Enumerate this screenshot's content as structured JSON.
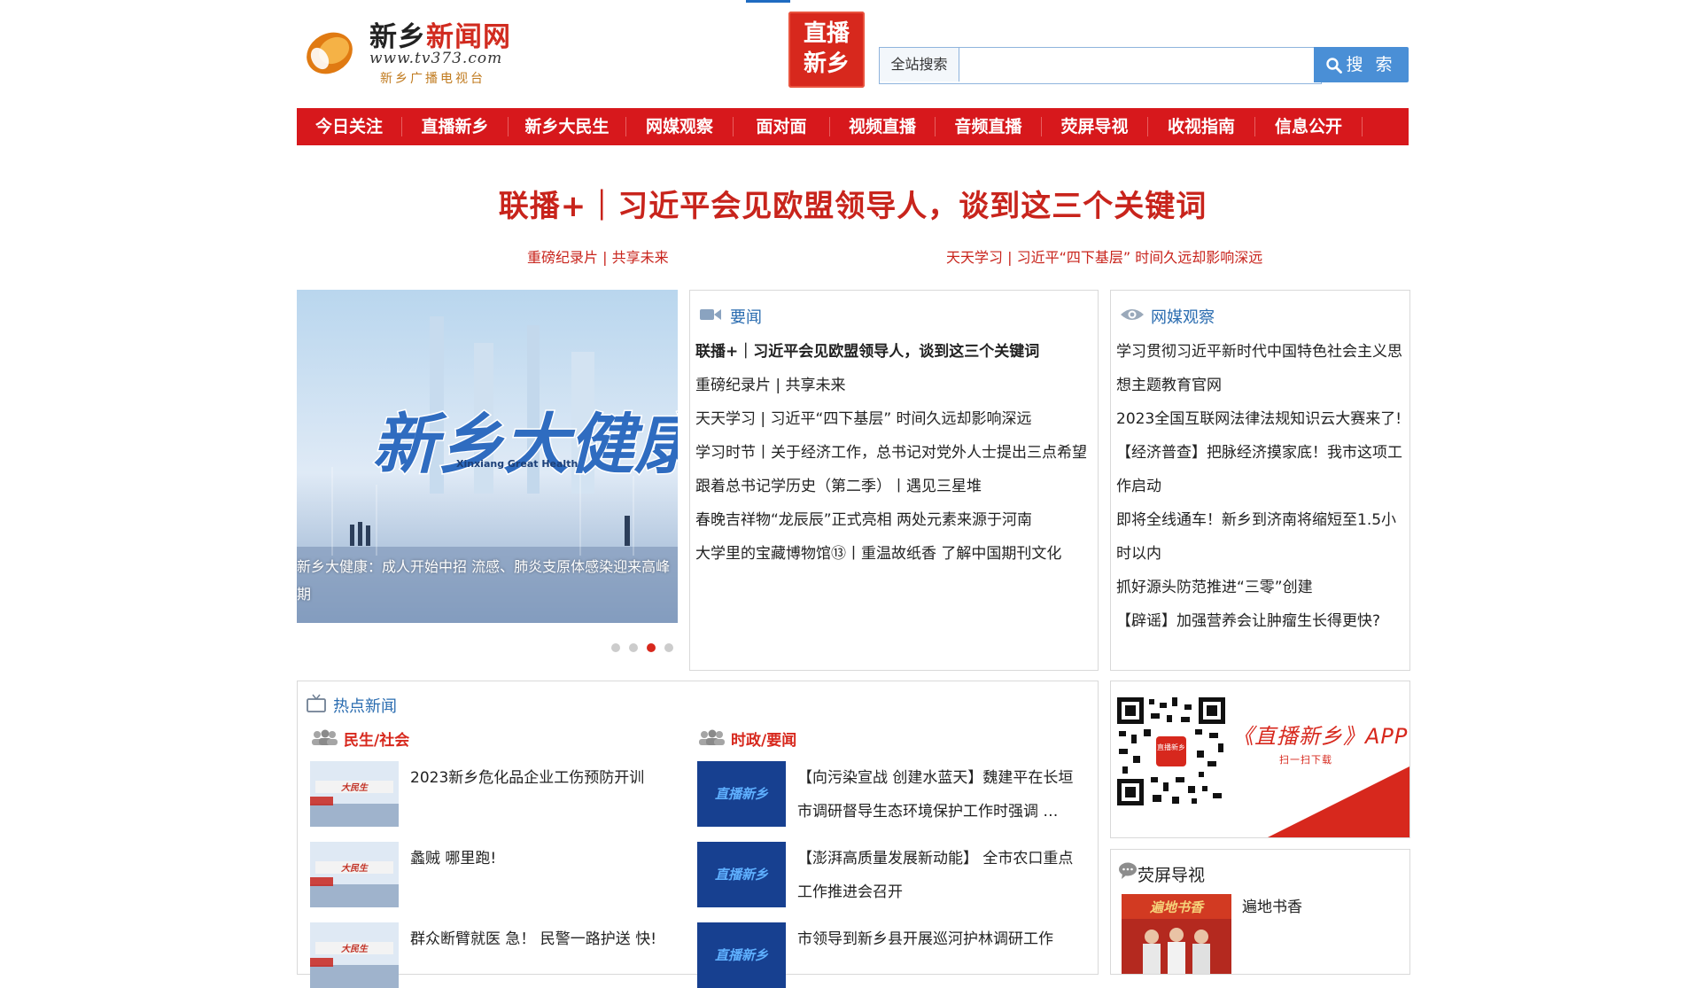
{
  "header": {
    "logo_title_black": "新乡",
    "logo_title_red": "新闻网",
    "logo_url": "www.tv373.com",
    "logo_subtitle": "新乡广播电视台",
    "live_badge_line1": "直播",
    "live_badge_line2": "新乡",
    "search_scope": "全站搜索",
    "search_placeholder": "",
    "search_button": "搜 索"
  },
  "nav": {
    "items": [
      "今日关注",
      "直播新乡",
      "新乡大民生",
      "网媒观察",
      "面对面",
      "视频直播",
      "音频直播",
      "荧屏导视",
      "收视指南",
      "信息公开"
    ]
  },
  "headline": {
    "title": "联播+｜习近平会见欧盟领导人，谈到这三个关键词",
    "sub_left": "重磅纪录片 | 共享未来",
    "sub_right": "天天学习 | 习近平“四下基层” 时间久远却影响深远"
  },
  "slider": {
    "brand_text": "新乡大健康",
    "brand_sub": "Xinxiang Great Health",
    "caption": "新乡大健康：成人开始中招 流感、肺炎支原体感染迎来高峰期",
    "dot_count": 4,
    "active_dot": 2
  },
  "yaowen": {
    "title": "要闻",
    "items": [
      "联播+｜习近平会见欧盟领导人，谈到这三个关键词",
      "重磅纪录片 | 共享未来",
      "天天学习 | 习近平“四下基层” 时间久远却影响深远",
      "学习时节丨关于经济工作，总书记对党外人士提出三点希望",
      "跟着总书记学历史（第二季）丨遇见三星堆",
      "春晚吉祥物“龙辰辰”正式亮相 两处元素来源于河南",
      "大学里的宝藏博物馆⑬丨重温故纸香 了解中国期刊文化"
    ]
  },
  "wangmei": {
    "title": "网媒观察",
    "items": [
      "学习贯彻习近平新时代中国特色社会主义思想主题教育官网",
      "2023全国互联网法律法规知识云大赛来了!",
      "【经济普查】把脉经济摸家底！我市这项工作启动",
      "即将全线通车！新乡到济南将缩短至1.5小时以内",
      "抓好源头防范推进“三零”创建",
      "【辟谣】加强营养会让肿瘤生长得更快?"
    ]
  },
  "hot": {
    "title": "热点新闻",
    "col_left": "民生/社会",
    "col_right": "时政/要闻",
    "thumb_left": "大民生",
    "thumb_right": "直播新乡",
    "left_items": [
      "2023新乡危化品企业工伤预防开训",
      "蠡贼 哪里跑!",
      "群众断臂就医 急！ 民警一路护送 快!"
    ],
    "right_items": [
      "【向污染宣战 创建水蓝天】魏建平在长垣市调研督导生态环境保护工作时强调 …",
      "【澎湃高质量发展新动能】 全市农口重点工作推进会召开",
      "市领导到新乡县开展巡河护林调研工作"
    ]
  },
  "app": {
    "qr_badge": "直播新乡",
    "title": "《直播新乡》APP",
    "subtitle": "扫一扫下载"
  },
  "yingping": {
    "title": "荧屏导视",
    "thumb_text": "遍地书香",
    "item": "遍地书香"
  },
  "colors": {
    "brand_red": "#d7181c",
    "link_blue": "#2a6cb0",
    "search_blue": "#4a8fd6"
  }
}
